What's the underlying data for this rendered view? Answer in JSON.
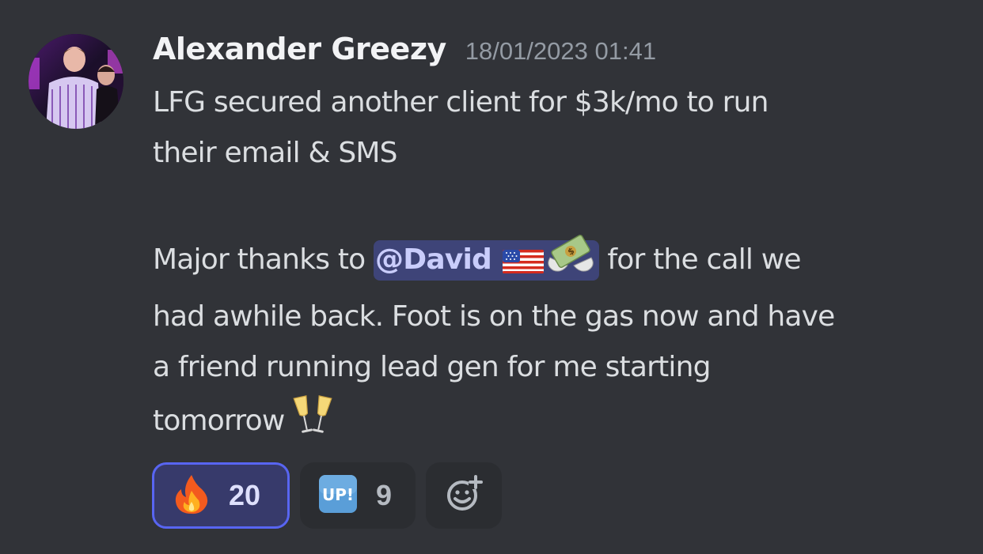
{
  "message": {
    "username": "Alexander Greezy",
    "timestamp": "18/01/2023 01:41",
    "line1": "LFG secured another client for $3k/mo to run",
    "line2": "their email & SMS",
    "para2_prefix": "Major thanks to ",
    "mention": "@David",
    "para2_rest_a": " for the call we",
    "para2_rest_b": "had awhile back. Foot is on the gas now and have",
    "para2_rest_c": "a friend running lead gen for me starting",
    "para2_rest_d": "tomorrow",
    "mention_emojis": [
      "flag-usa-icon",
      "money-with-wings-icon"
    ],
    "trailing_emoji": "champagne-glasses-icon"
  },
  "reactions": [
    {
      "icon": "fire-icon",
      "count": "20",
      "active": true
    },
    {
      "icon": "up-button-icon",
      "count": "9",
      "active": false
    }
  ],
  "add_reaction": {
    "icon": "add-reaction-icon"
  },
  "colors": {
    "background": "#313338",
    "mention_bg": "#3d4270",
    "active_border": "#5865f2",
    "username": "#f2f3f5",
    "timestamp": "#949ba4"
  }
}
